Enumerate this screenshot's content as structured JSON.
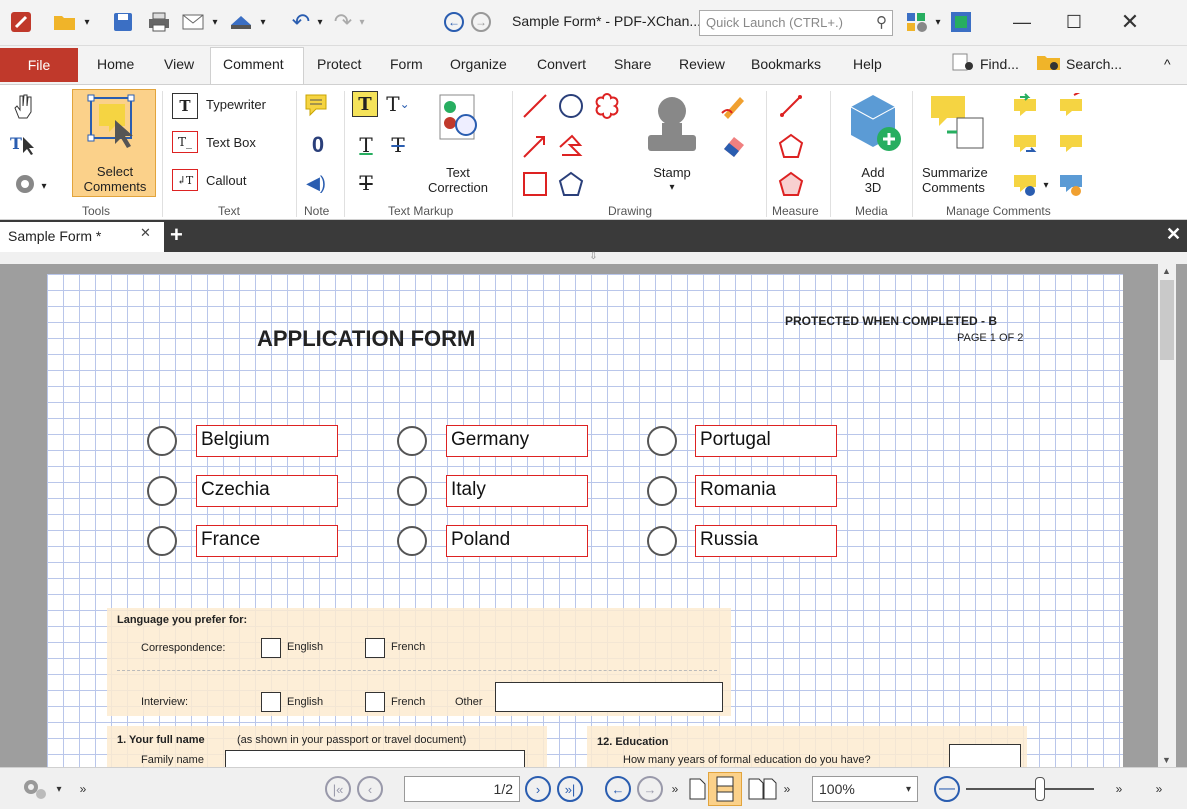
{
  "window": {
    "title": "Sample Form* - PDF-XChan...",
    "quick_launch_placeholder": "Quick Launch (CTRL+.)"
  },
  "menu": {
    "file": "File",
    "tabs": [
      "Home",
      "View",
      "Comment",
      "Protect",
      "Form",
      "Organize",
      "Convert",
      "Share",
      "Review",
      "Bookmarks",
      "Help"
    ],
    "active_tab": "Comment",
    "find": "Find...",
    "search": "Search..."
  },
  "ribbon": {
    "tools": {
      "select_comments": "Select\nComments",
      "group": "Tools"
    },
    "text": {
      "typewriter": "Typewriter",
      "text_box": "Text Box",
      "callout": "Callout",
      "group": "Text"
    },
    "note": {
      "group": "Note"
    },
    "text_markup": {
      "text_correction": "Text\nCorrection",
      "group": "Text Markup"
    },
    "drawing": {
      "stamp": "Stamp",
      "group": "Drawing"
    },
    "measure": {
      "group": "Measure"
    },
    "media": {
      "add_3d": "Add\n3D",
      "group": "Media"
    },
    "manage": {
      "summarize": "Summarize\nComments",
      "group": "Manage Comments"
    }
  },
  "doc_tab": {
    "label": "Sample Form *"
  },
  "document": {
    "title": "APPLICATION FORM",
    "protected": "PROTECTED WHEN COMPLETED - B",
    "page_label": "PAGE 1 OF 2",
    "countries": [
      [
        "Belgium",
        "Germany",
        "Portugal"
      ],
      [
        "Czechia",
        "Italy",
        "Romania"
      ],
      [
        "France",
        "Poland",
        "Russia"
      ]
    ],
    "language_label": "Language you prefer for:",
    "correspondence": "Correspondence:",
    "interview": "Interview:",
    "english": "English",
    "french": "French",
    "other": "Other",
    "q1": "1.   Your full name",
    "q1_note": "(as shown in your passport or travel document)",
    "family_name": "Family name",
    "q12": "12.  Education",
    "q12_text": "How many years of formal education do you have?"
  },
  "status": {
    "page": "1/2",
    "zoom": "100%"
  },
  "colors": {
    "file_tab": "#c0392b",
    "field_border": "#dd2222",
    "grid": "#b9c6ea",
    "form_bg": "#fdebd0"
  }
}
